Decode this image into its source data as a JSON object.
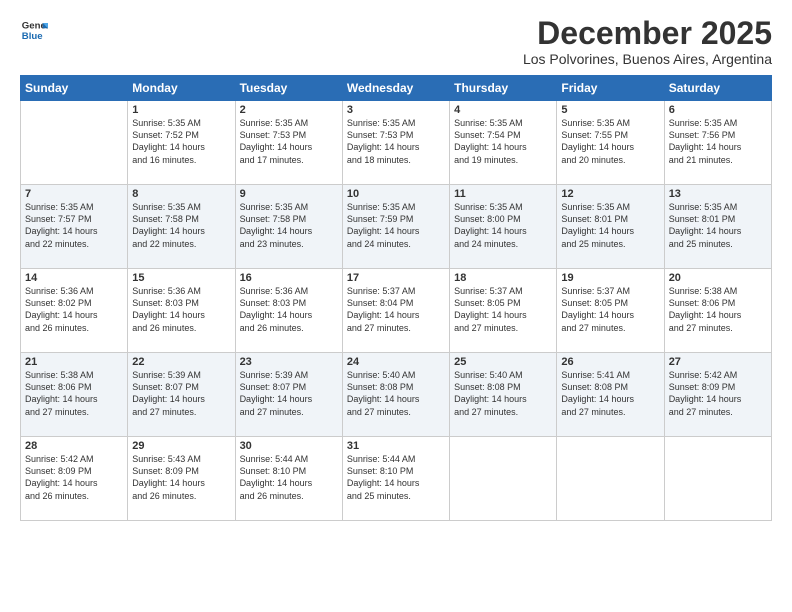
{
  "header": {
    "logo_line1": "General",
    "logo_line2": "Blue",
    "month_title": "December 2025",
    "subtitle": "Los Polvorines, Buenos Aires, Argentina"
  },
  "weekdays": [
    "Sunday",
    "Monday",
    "Tuesday",
    "Wednesday",
    "Thursday",
    "Friday",
    "Saturday"
  ],
  "weeks": [
    [
      {
        "day": "",
        "info": ""
      },
      {
        "day": "1",
        "info": "Sunrise: 5:35 AM\nSunset: 7:52 PM\nDaylight: 14 hours\nand 16 minutes."
      },
      {
        "day": "2",
        "info": "Sunrise: 5:35 AM\nSunset: 7:53 PM\nDaylight: 14 hours\nand 17 minutes."
      },
      {
        "day": "3",
        "info": "Sunrise: 5:35 AM\nSunset: 7:53 PM\nDaylight: 14 hours\nand 18 minutes."
      },
      {
        "day": "4",
        "info": "Sunrise: 5:35 AM\nSunset: 7:54 PM\nDaylight: 14 hours\nand 19 minutes."
      },
      {
        "day": "5",
        "info": "Sunrise: 5:35 AM\nSunset: 7:55 PM\nDaylight: 14 hours\nand 20 minutes."
      },
      {
        "day": "6",
        "info": "Sunrise: 5:35 AM\nSunset: 7:56 PM\nDaylight: 14 hours\nand 21 minutes."
      }
    ],
    [
      {
        "day": "7",
        "info": "Sunrise: 5:35 AM\nSunset: 7:57 PM\nDaylight: 14 hours\nand 22 minutes."
      },
      {
        "day": "8",
        "info": "Sunrise: 5:35 AM\nSunset: 7:58 PM\nDaylight: 14 hours\nand 22 minutes."
      },
      {
        "day": "9",
        "info": "Sunrise: 5:35 AM\nSunset: 7:58 PM\nDaylight: 14 hours\nand 23 minutes."
      },
      {
        "day": "10",
        "info": "Sunrise: 5:35 AM\nSunset: 7:59 PM\nDaylight: 14 hours\nand 24 minutes."
      },
      {
        "day": "11",
        "info": "Sunrise: 5:35 AM\nSunset: 8:00 PM\nDaylight: 14 hours\nand 24 minutes."
      },
      {
        "day": "12",
        "info": "Sunrise: 5:35 AM\nSunset: 8:01 PM\nDaylight: 14 hours\nand 25 minutes."
      },
      {
        "day": "13",
        "info": "Sunrise: 5:35 AM\nSunset: 8:01 PM\nDaylight: 14 hours\nand 25 minutes."
      }
    ],
    [
      {
        "day": "14",
        "info": "Sunrise: 5:36 AM\nSunset: 8:02 PM\nDaylight: 14 hours\nand 26 minutes."
      },
      {
        "day": "15",
        "info": "Sunrise: 5:36 AM\nSunset: 8:03 PM\nDaylight: 14 hours\nand 26 minutes."
      },
      {
        "day": "16",
        "info": "Sunrise: 5:36 AM\nSunset: 8:03 PM\nDaylight: 14 hours\nand 26 minutes."
      },
      {
        "day": "17",
        "info": "Sunrise: 5:37 AM\nSunset: 8:04 PM\nDaylight: 14 hours\nand 27 minutes."
      },
      {
        "day": "18",
        "info": "Sunrise: 5:37 AM\nSunset: 8:05 PM\nDaylight: 14 hours\nand 27 minutes."
      },
      {
        "day": "19",
        "info": "Sunrise: 5:37 AM\nSunset: 8:05 PM\nDaylight: 14 hours\nand 27 minutes."
      },
      {
        "day": "20",
        "info": "Sunrise: 5:38 AM\nSunset: 8:06 PM\nDaylight: 14 hours\nand 27 minutes."
      }
    ],
    [
      {
        "day": "21",
        "info": "Sunrise: 5:38 AM\nSunset: 8:06 PM\nDaylight: 14 hours\nand 27 minutes."
      },
      {
        "day": "22",
        "info": "Sunrise: 5:39 AM\nSunset: 8:07 PM\nDaylight: 14 hours\nand 27 minutes."
      },
      {
        "day": "23",
        "info": "Sunrise: 5:39 AM\nSunset: 8:07 PM\nDaylight: 14 hours\nand 27 minutes."
      },
      {
        "day": "24",
        "info": "Sunrise: 5:40 AM\nSunset: 8:08 PM\nDaylight: 14 hours\nand 27 minutes."
      },
      {
        "day": "25",
        "info": "Sunrise: 5:40 AM\nSunset: 8:08 PM\nDaylight: 14 hours\nand 27 minutes."
      },
      {
        "day": "26",
        "info": "Sunrise: 5:41 AM\nSunset: 8:08 PM\nDaylight: 14 hours\nand 27 minutes."
      },
      {
        "day": "27",
        "info": "Sunrise: 5:42 AM\nSunset: 8:09 PM\nDaylight: 14 hours\nand 27 minutes."
      }
    ],
    [
      {
        "day": "28",
        "info": "Sunrise: 5:42 AM\nSunset: 8:09 PM\nDaylight: 14 hours\nand 26 minutes."
      },
      {
        "day": "29",
        "info": "Sunrise: 5:43 AM\nSunset: 8:09 PM\nDaylight: 14 hours\nand 26 minutes."
      },
      {
        "day": "30",
        "info": "Sunrise: 5:44 AM\nSunset: 8:10 PM\nDaylight: 14 hours\nand 26 minutes."
      },
      {
        "day": "31",
        "info": "Sunrise: 5:44 AM\nSunset: 8:10 PM\nDaylight: 14 hours\nand 25 minutes."
      },
      {
        "day": "",
        "info": ""
      },
      {
        "day": "",
        "info": ""
      },
      {
        "day": "",
        "info": ""
      }
    ]
  ]
}
